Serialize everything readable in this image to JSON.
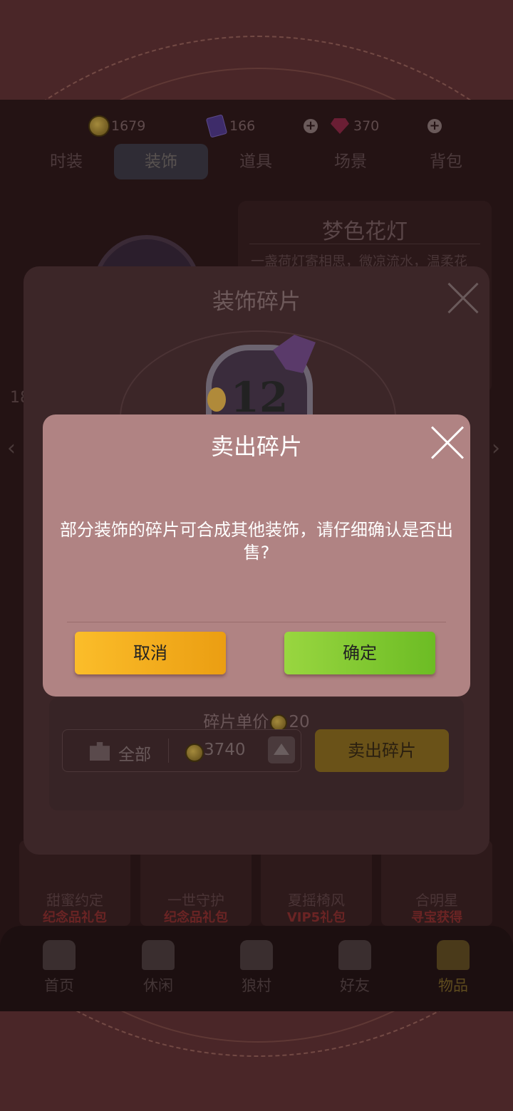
{
  "currency": {
    "coins": "1679",
    "cards": "166",
    "gems": "370"
  },
  "tabs": [
    {
      "label": "时装"
    },
    {
      "label": "装饰"
    },
    {
      "label": "道具"
    },
    {
      "label": "场景"
    },
    {
      "label": "背包"
    }
  ],
  "active_tab": "装饰",
  "detail": {
    "title": "梦色花灯",
    "description": "一盏荷灯寄相思，微凉流水，温柔花"
  },
  "side_number": "18",
  "items": [
    {
      "name": "甜蜜约定",
      "tag": "纪念品礼包"
    },
    {
      "name": "一世守护",
      "tag": "纪念品礼包"
    },
    {
      "name": "夏摇椅风",
      "tag": "VIP5礼包"
    },
    {
      "name": "合明星",
      "tag": "寻宝获得"
    }
  ],
  "bottom_nav": [
    {
      "label": "首页",
      "icon": "home-icon"
    },
    {
      "label": "休闲",
      "icon": "leisure-icon"
    },
    {
      "label": "狼村",
      "icon": "village-icon"
    },
    {
      "label": "好友",
      "icon": "friends-icon"
    },
    {
      "label": "物品",
      "icon": "items-icon"
    }
  ],
  "fragment_dialog": {
    "title": "装饰碎片",
    "emblem_number": "12",
    "unit_price_label": "碎片单价",
    "unit_price": "20",
    "quantity_label": "全部",
    "total": "3740",
    "sell_button": "卖出碎片"
  },
  "confirm_dialog": {
    "title": "卖出碎片",
    "message": "部分装饰的碎片可合成其他装饰，请仔细确认是否出售?",
    "cancel": "取消",
    "confirm": "确定"
  }
}
